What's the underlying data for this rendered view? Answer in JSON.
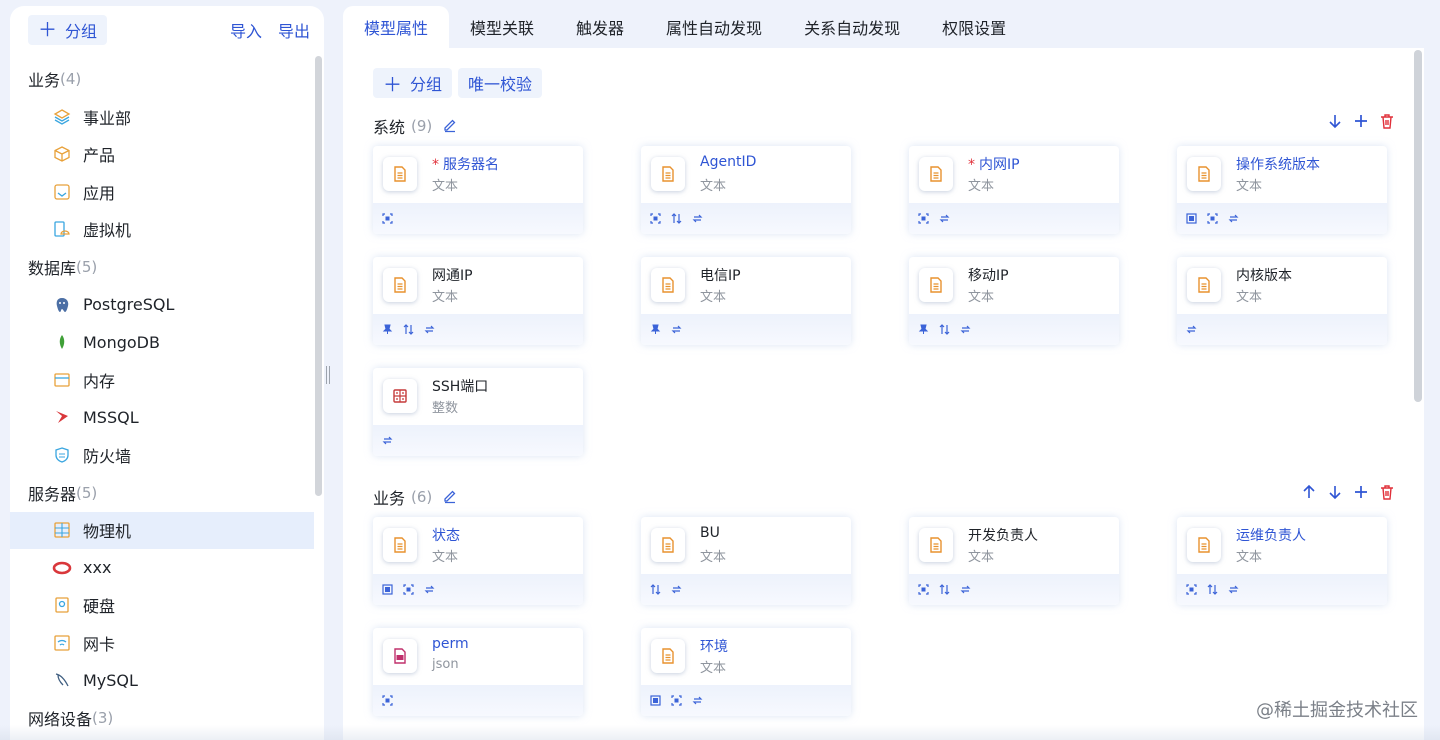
{
  "sidebar": {
    "add_group_label": "分组",
    "import_label": "导入",
    "export_label": "导出",
    "groups": [
      {
        "name": "业务",
        "count": "(4)",
        "items": [
          "事业部",
          "产品",
          "应用",
          "虚拟机"
        ]
      },
      {
        "name": "数据库",
        "count": "(5)",
        "items": [
          "PostgreSQL",
          "MongoDB",
          "内存",
          "MSSQL",
          "防火墙"
        ]
      },
      {
        "name": "服务器",
        "count": "(5)",
        "items": [
          "物理机",
          "xxx",
          "硬盘",
          "网卡",
          "MySQL"
        ]
      },
      {
        "name": "网络设备",
        "count": "(3)",
        "items": []
      }
    ],
    "active_item": "物理机"
  },
  "tabs": [
    "模型属性",
    "模型关联",
    "触发器",
    "属性自动发现",
    "关系自动发现",
    "权限设置"
  ],
  "active_tab": "模型属性",
  "toolbar": {
    "add_group_label": "分组",
    "unique_check_label": "唯一校验"
  },
  "sections": [
    {
      "name": "系统",
      "count": "(9)",
      "fields": [
        {
          "name": "服务器名",
          "type": "文本",
          "required": true,
          "blue": true,
          "icons": [
            "scan-icon"
          ]
        },
        {
          "name": "AgentID",
          "type": "文本",
          "required": false,
          "blue": true,
          "icons": [
            "scan-icon",
            "sort-icon",
            "sync-icon"
          ]
        },
        {
          "name": "内网IP",
          "type": "文本",
          "required": true,
          "blue": true,
          "icons": [
            "scan-icon",
            "sync-icon"
          ]
        },
        {
          "name": "操作系统版本",
          "type": "文本",
          "required": false,
          "blue": true,
          "icons": [
            "list-icon",
            "scan-icon",
            "sync-icon"
          ]
        },
        {
          "name": "网通IP",
          "type": "文本",
          "required": false,
          "blue": false,
          "icons": [
            "pin-icon",
            "sort-icon",
            "sync-icon"
          ]
        },
        {
          "name": "电信IP",
          "type": "文本",
          "required": false,
          "blue": false,
          "icons": [
            "pin-icon",
            "sync-icon"
          ]
        },
        {
          "name": "移动IP",
          "type": "文本",
          "required": false,
          "blue": false,
          "icons": [
            "pin-icon",
            "sort-icon",
            "sync-icon"
          ]
        },
        {
          "name": "内核版本",
          "type": "文本",
          "required": false,
          "blue": false,
          "icons": [
            "sync-icon"
          ]
        },
        {
          "name": "SSH端口",
          "type": "整数",
          "required": false,
          "blue": false,
          "icons": [
            "sync-icon"
          ],
          "kind": "int"
        }
      ]
    },
    {
      "name": "业务",
      "count": "(6)",
      "fields": [
        {
          "name": "状态",
          "type": "文本",
          "required": false,
          "blue": true,
          "icons": [
            "list-icon",
            "scan-icon",
            "sync-icon"
          ]
        },
        {
          "name": "BU",
          "type": "文本",
          "required": false,
          "blue": false,
          "icons": [
            "sort-icon",
            "sync-icon"
          ]
        },
        {
          "name": "开发负责人",
          "type": "文本",
          "required": false,
          "blue": false,
          "icons": [
            "scan-icon",
            "sort-icon",
            "sync-icon"
          ]
        },
        {
          "name": "运维负责人",
          "type": "文本",
          "required": false,
          "blue": true,
          "icons": [
            "scan-icon",
            "sort-icon",
            "sync-icon"
          ]
        },
        {
          "name": "perm",
          "type": "json",
          "required": false,
          "blue": true,
          "icons": [
            "scan-icon"
          ],
          "kind": "json"
        },
        {
          "name": "环境",
          "type": "文本",
          "required": false,
          "blue": true,
          "icons": [
            "list-icon",
            "scan-icon",
            "sync-icon"
          ]
        }
      ]
    }
  ],
  "watermark": "@稀土掘金技术社区",
  "colors": {
    "accent": "#2f55d4",
    "danger": "#e0303a",
    "file_icon": "#e8922f",
    "json_icon": "#c0306c",
    "int_icon": "#c53a3a"
  }
}
